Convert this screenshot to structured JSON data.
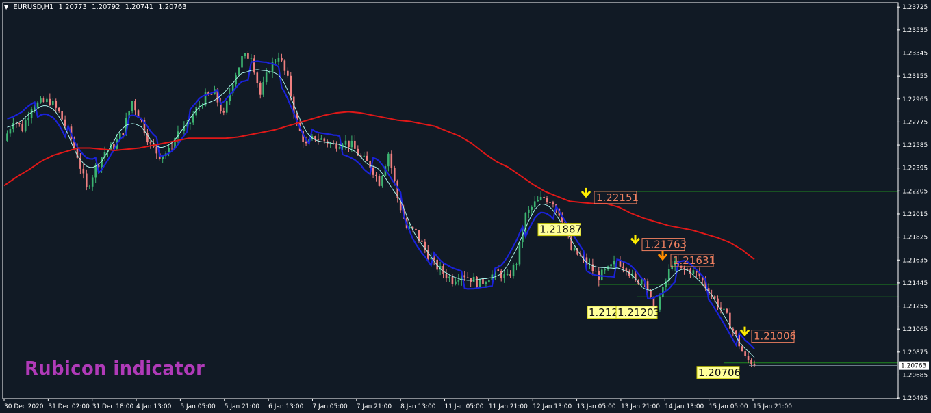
{
  "header": {
    "symbol": "EURUSD,H1",
    "open": "1.20773",
    "high": "1.20792",
    "low": "1.20741",
    "close": "1.20763"
  },
  "watermark": "Rubicon indicator",
  "current_price": "1.20763",
  "colors": {
    "background": "#111a25",
    "bull_candle": "#3cb371",
    "bear_candle": "#f08080",
    "ma_slow": "#e01818",
    "envelope": "#1a22d8",
    "signal_line": "#a8f0e8",
    "support_line": "#1f8a1f",
    "sell_arrow": "#ffee00",
    "alt_arrow": "#ff8c00",
    "resistance_label": "#f08060",
    "support_label": "#ffee44"
  },
  "chart_data": {
    "type": "candlestick",
    "symbol": "EURUSD",
    "timeframe": "H1",
    "y_ticks": [
      "1.23725",
      "1.23535",
      "1.23345",
      "1.23155",
      "1.22965",
      "1.22775",
      "1.22585",
      "1.22395",
      "1.22205",
      "1.22015",
      "1.21825",
      "1.21635",
      "1.21445",
      "1.21255",
      "1.21065",
      "1.20875",
      "1.20685",
      "1.20495"
    ],
    "x_ticks": [
      "30 Dec 2020",
      "31 Dec 02:00",
      "31 Dec 18:00",
      "4 Jan 13:00",
      "5 Jan 05:00",
      "5 Jan 21:00",
      "6 Jan 13:00",
      "7 Jan 05:00",
      "7 Jan 21:00",
      "8 Jan 13:00",
      "11 Jan 05:00",
      "11 Jan 21:00",
      "12 Jan 13:00",
      "13 Jan 05:00",
      "13 Jan 21:00",
      "14 Jan 13:00",
      "15 Jan 05:00",
      "15 Jan 21:00"
    ],
    "ylim": [
      1.2049,
      1.2376
    ],
    "close_path": [
      1.2262,
      1.228,
      1.2272,
      1.2291,
      1.2293,
      1.2295,
      1.2285,
      1.227,
      1.225,
      1.2222,
      1.224,
      1.2253,
      1.2258,
      1.227,
      1.2295,
      1.2278,
      1.2258,
      1.225,
      1.2253,
      1.227,
      1.2272,
      1.2288,
      1.2298,
      1.2301,
      1.2282,
      1.2312,
      1.233,
      1.2333,
      1.23,
      1.2322,
      1.2333,
      1.2312,
      1.2275,
      1.2258,
      1.2265,
      1.2262,
      1.2258,
      1.2262,
      1.2258,
      1.2248,
      1.2242,
      1.2228,
      1.2252,
      1.2215,
      1.219,
      1.2186,
      1.2172,
      1.216,
      1.2153,
      1.2147,
      1.2153,
      1.2148,
      1.2144,
      1.215,
      1.2153,
      1.2148,
      1.2162,
      1.22,
      1.221,
      1.2215,
      1.2212,
      1.2198,
      1.2172,
      1.2166,
      1.2158,
      1.215,
      1.2155,
      1.2163,
      1.2158,
      1.2145,
      1.215,
      1.212,
      1.2138,
      1.2162,
      1.2155,
      1.2155,
      1.215,
      1.2138,
      1.2127,
      1.2116,
      1.21,
      1.2082,
      1.2078
    ],
    "series": [
      {
        "name": "MA",
        "values": [
          1.2225,
          1.2232,
          1.2238,
          1.2245,
          1.225,
          1.2253,
          1.2256,
          1.2256,
          1.2255,
          1.2254,
          1.2255,
          1.2256,
          1.2258,
          1.226,
          1.2262,
          1.2264,
          1.2264,
          1.2264,
          1.2264,
          1.2265,
          1.2267,
          1.2269,
          1.2271,
          1.2274,
          1.2277,
          1.228,
          1.2283,
          1.2285,
          1.2286,
          1.2285,
          1.2283,
          1.2281,
          1.2279,
          1.2278,
          1.2276,
          1.2274,
          1.227,
          1.2266,
          1.226,
          1.2252,
          1.2245,
          1.224,
          1.2233,
          1.2226,
          1.222,
          1.2216,
          1.2212,
          1.2211,
          1.221,
          1.221,
          1.2207,
          1.2202,
          1.2198,
          1.2195,
          1.2192,
          1.219,
          1.2188,
          1.2185,
          1.2182,
          1.2178,
          1.2172,
          1.2164
        ]
      }
    ],
    "signals": [
      {
        "type": "sell",
        "level": "1.22151"
      },
      {
        "type": "sell",
        "level": "1.21763"
      },
      {
        "type": "alt",
        "level": "1.21631"
      },
      {
        "type": "sell",
        "level": "1.21006"
      }
    ],
    "resistance_levels": [
      "1.22151",
      "1.21763",
      "1.21631",
      "1.21006"
    ],
    "support_levels": [
      "1.21887",
      "1.21203",
      "1.21203",
      "1.20706"
    ],
    "grid": false,
    "legend": "none"
  }
}
